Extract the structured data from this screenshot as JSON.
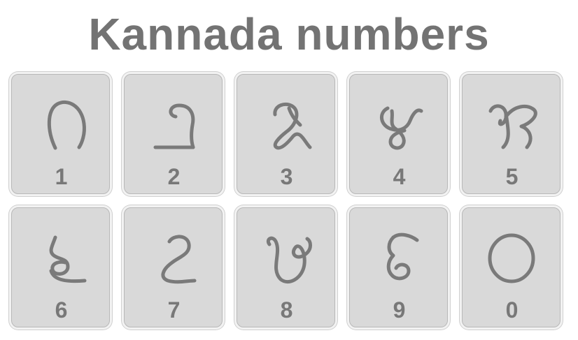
{
  "title": "Kannada numbers",
  "accent_color": "#787878",
  "tile_color": "#d9d9d9",
  "tiles": [
    {
      "glyph": "kannada-digit-1-glyph",
      "label": "1"
    },
    {
      "glyph": "kannada-digit-2-glyph",
      "label": "2"
    },
    {
      "glyph": "kannada-digit-3-glyph",
      "label": "3"
    },
    {
      "glyph": "kannada-digit-4-glyph",
      "label": "4"
    },
    {
      "glyph": "kannada-digit-5-glyph",
      "label": "5"
    },
    {
      "glyph": "kannada-digit-6-glyph",
      "label": "6"
    },
    {
      "glyph": "kannada-digit-7-glyph",
      "label": "7"
    },
    {
      "glyph": "kannada-digit-8-glyph",
      "label": "8"
    },
    {
      "glyph": "kannada-digit-9-glyph",
      "label": "9"
    },
    {
      "glyph": "kannada-digit-0-glyph",
      "label": "0"
    }
  ]
}
